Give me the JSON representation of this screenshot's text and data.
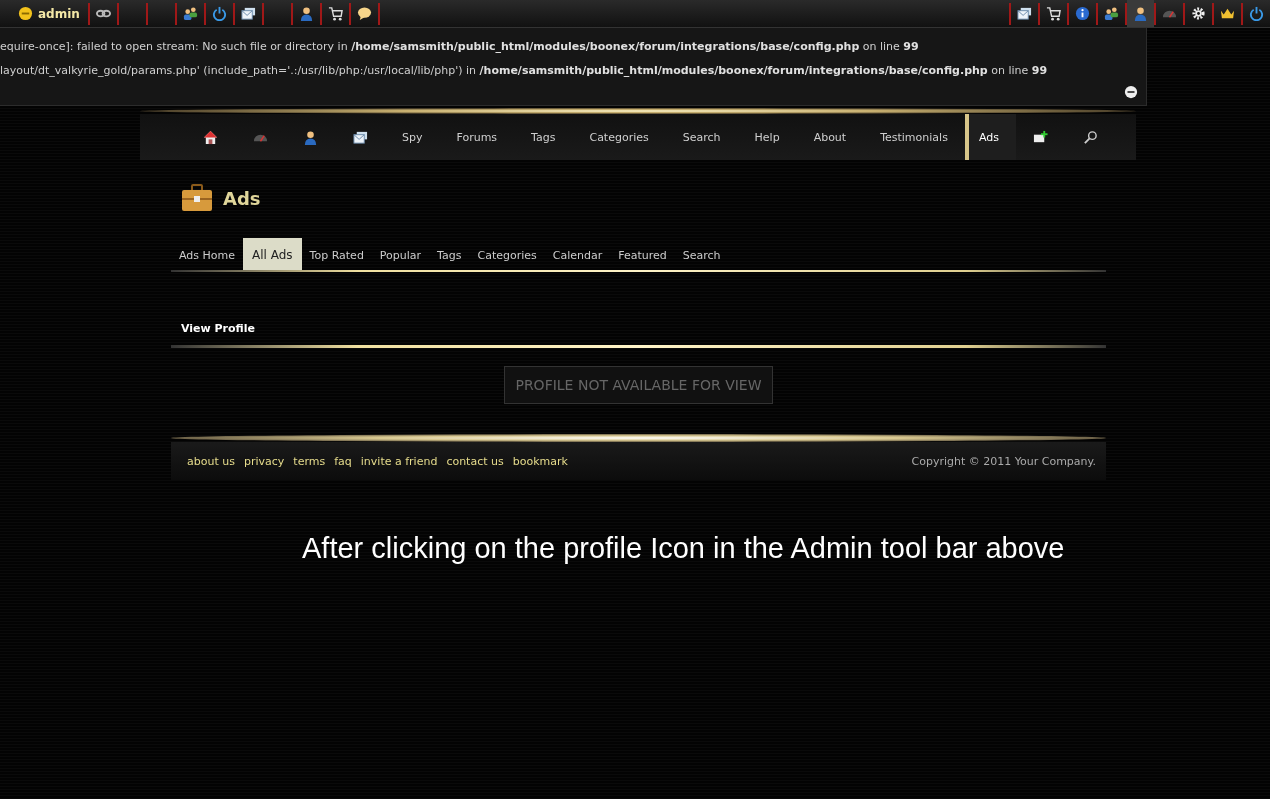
{
  "toolbar": {
    "user": "admin",
    "left_items": [
      {
        "selected": false
      },
      {
        "selected": false
      },
      {
        "selected": false
      },
      {
        "selected": false
      },
      {
        "selected": false
      },
      {
        "selected": false
      },
      {
        "selected": false
      }
    ],
    "right_items": [
      {
        "selected": false
      },
      {
        "selected": false
      },
      {
        "selected": false
      },
      {
        "selected": false
      },
      {
        "selected": true
      },
      {
        "selected": false
      },
      {
        "selected": false
      },
      {
        "selected": false
      },
      {
        "selected": false
      }
    ]
  },
  "errors": [
    "equire-once]: failed to open stream: No such file or directory in **/home/samsmith/public_html/modules/boonex/forum/integrations/base/config.php** on line **99**",
    "layout/dt_valkyrie_gold/params.php' (include_path='.:/usr/lib/php:/usr/local/lib/php') in **/home/samsmith/public_html/modules/boonex/forum/integrations/base/config.php** on line **99**"
  ],
  "nav": [
    {
      "kind": "icon",
      "selected": false
    },
    {
      "kind": "icon",
      "selected": false
    },
    {
      "kind": "icon",
      "selected": false
    },
    {
      "kind": "icon",
      "selected": false
    },
    {
      "kind": "text",
      "label": "Spy",
      "selected": false
    },
    {
      "kind": "text",
      "label": "Forums",
      "selected": false
    },
    {
      "kind": "text",
      "label": "Tags",
      "selected": false
    },
    {
      "kind": "text",
      "label": "Categories",
      "selected": false
    },
    {
      "kind": "text",
      "label": "Search",
      "selected": false
    },
    {
      "kind": "text",
      "label": "Help",
      "selected": false
    },
    {
      "kind": "text",
      "label": "About",
      "selected": false
    },
    {
      "kind": "text",
      "label": "Testimonials",
      "selected": false
    },
    {
      "kind": "text",
      "label": "Ads",
      "selected": true
    },
    {
      "kind": "icon",
      "selected": false
    },
    {
      "kind": "icon",
      "selected": false
    }
  ],
  "page_title": "Ads",
  "subtabs": [
    {
      "label": "Ads Home",
      "selected": false
    },
    {
      "label": "All Ads",
      "selected": true
    },
    {
      "label": "Top Rated",
      "selected": false
    },
    {
      "label": "Popular",
      "selected": false
    },
    {
      "label": "Tags",
      "selected": false
    },
    {
      "label": "Categories",
      "selected": false
    },
    {
      "label": "Calendar",
      "selected": false
    },
    {
      "label": "Featured",
      "selected": false
    },
    {
      "label": "Search",
      "selected": false
    }
  ],
  "section_title": "View Profile",
  "message": "PROFILE NOT AVAILABLE FOR VIEW",
  "footer": {
    "links": [
      "about us",
      "privacy",
      "terms",
      "faq",
      "invite a friend",
      "contact us",
      "bookmark"
    ],
    "copyright": "Copyright © 2011 Your Company."
  },
  "caption": "After clicking on the profile Icon in the Admin tool bar above"
}
